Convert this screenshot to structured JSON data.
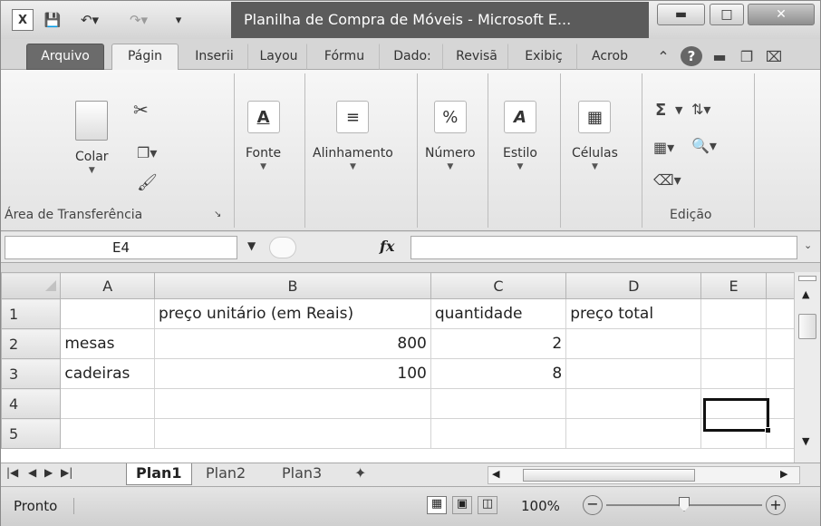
{
  "app": {
    "title": "Planilha de Compra de Móveis  -  Microsoft E..."
  },
  "tabs": [
    "Arquivo",
    "Págin",
    "Inserii",
    "Layou",
    "Fórmu",
    "Dado:",
    "Revisã",
    "Exibiç",
    "Acrob"
  ],
  "ribbon": {
    "clipboard": {
      "paste": "Colar",
      "group_label": "Área de Transferência"
    },
    "font": "Fonte",
    "alignment": "Alinhamento",
    "number": "Número",
    "style": "Estilo",
    "cells": "Células",
    "editing": "Edição",
    "icons": {
      "font": "A",
      "number": "%",
      "sigma": "Σ"
    }
  },
  "formula_bar": {
    "name_box": "E4",
    "fx": "fx",
    "value": ""
  },
  "grid": {
    "columns": [
      "A",
      "B",
      "C",
      "D",
      "E"
    ],
    "rows": [
      "1",
      "2",
      "3",
      "4",
      "5"
    ],
    "cells": [
      [
        "",
        "preço unitário (em Reais)",
        "quantidade",
        "preço total",
        ""
      ],
      [
        "mesas",
        "800",
        "2",
        "",
        ""
      ],
      [
        "cadeiras",
        "100",
        "8",
        "",
        ""
      ],
      [
        "",
        "",
        "",
        "",
        ""
      ],
      [
        "",
        "",
        "",
        "",
        ""
      ]
    ],
    "selected_cell": "E4"
  },
  "sheets": [
    "Plan1",
    "Plan2",
    "Plan3"
  ],
  "status": {
    "ready": "Pronto",
    "zoom": "100%"
  }
}
